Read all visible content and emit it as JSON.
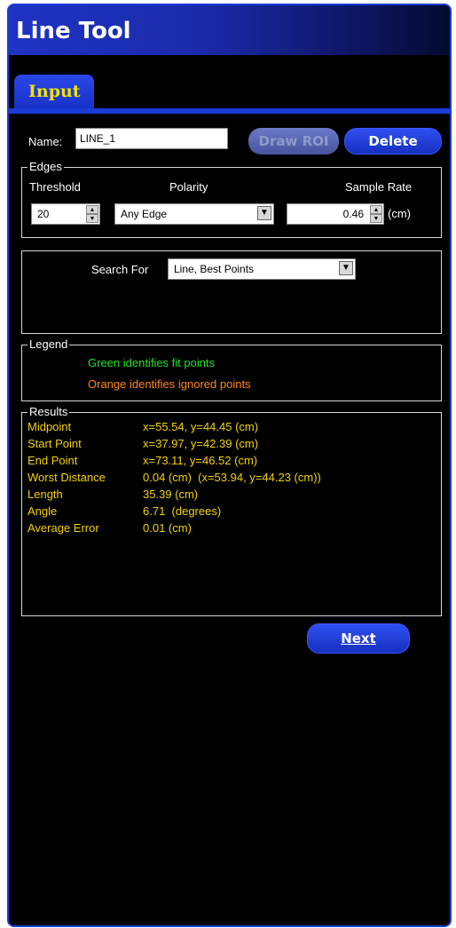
{
  "title": "Line Tool",
  "tab": "Input",
  "name": {
    "label": "Name:",
    "value": "LINE_1"
  },
  "buttons": {
    "draw_roi": "Draw ROI",
    "delete": "Delete",
    "next": "Next"
  },
  "edges": {
    "title": "Edges",
    "threshold_label": "Threshold",
    "threshold_value": "20",
    "polarity_label": "Polarity",
    "polarity_value": "Any Edge",
    "sample_rate_label": "Sample Rate",
    "sample_rate_value": "0.46",
    "sample_rate_unit": "(cm)"
  },
  "search": {
    "label": "Search For",
    "value": "Line, Best Points"
  },
  "legend": {
    "title": "Legend",
    "green_text": "Green identifies fit points",
    "orange_text": "Orange identifies ignored points",
    "green_color": "#22e022",
    "orange_color": "#ff8a10"
  },
  "results": {
    "title": "Results",
    "rows": [
      {
        "label": "Midpoint",
        "value": "x=55.54, y=44.45 (cm)"
      },
      {
        "label": "Start Point",
        "value": "x=37.97, y=42.39 (cm)"
      },
      {
        "label": "End Point",
        "value": "x=73.11, y=46.52 (cm)"
      },
      {
        "label": "Worst Distance",
        "value": "0.04 (cm)  (x=53.94, y=44.23 (cm))"
      },
      {
        "label": "Length",
        "value": "35.39 (cm)"
      },
      {
        "label": "Angle",
        "value": "6.71  (degrees)"
      },
      {
        "label": "Average Error",
        "value": "0.01 (cm)"
      }
    ]
  }
}
